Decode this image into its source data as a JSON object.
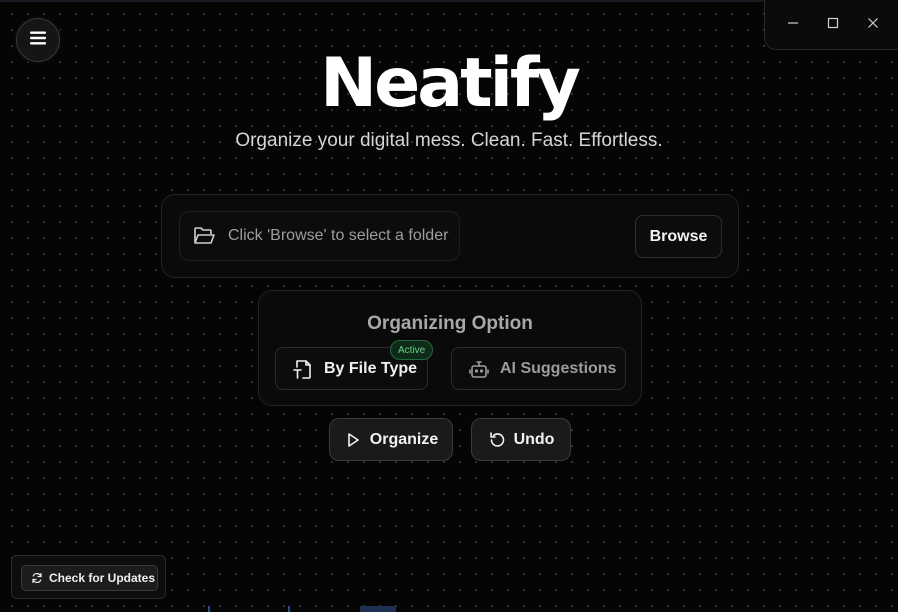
{
  "app": {
    "title": "Neatify",
    "subtitle": "Organize your digital mess. Clean. Fast. Effortless."
  },
  "window_controls": {
    "minimize_icon": "minimize-icon",
    "maximize_icon": "maximize-icon",
    "close_icon": "close-icon"
  },
  "menu": {
    "icon": "hamburger-menu-icon"
  },
  "folder": {
    "icon": "folder-open-icon",
    "placeholder": "Click 'Browse' to select a folder",
    "browse_label": "Browse"
  },
  "options": {
    "title": "Organizing Option",
    "items": [
      {
        "label": "By File Type",
        "icon": "file-type-icon",
        "badge": "Active",
        "active": true
      },
      {
        "label": "AI Suggestions",
        "icon": "robot-icon",
        "active": false
      }
    ]
  },
  "actions": {
    "organize_label": "Organize",
    "organize_icon": "play-icon",
    "undo_label": "Undo",
    "undo_icon": "undo-icon"
  },
  "updates": {
    "label": "Check for Updates",
    "icon": "refresh-icon"
  },
  "colors": {
    "background": "#050505",
    "active_badge": "#62d58b",
    "card_border": "#232323"
  }
}
